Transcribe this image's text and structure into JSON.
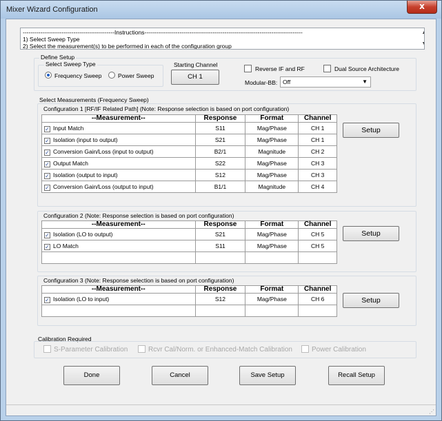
{
  "window": {
    "title": "Mixer Wizard Configuration",
    "close_glyph": "x"
  },
  "instructions": {
    "header": "-----------------------------------------------Instructions---------------------------------------------------------------------------------",
    "lines": [
      "1) Select Sweep Type",
      "2) Select the measurement(s) to be performed in each of the configuration group"
    ]
  },
  "define_setup": {
    "group_label": "Define Setup",
    "sweep_type_label": "Select Sweep Type",
    "frequency_sweep": "Frequency Sweep",
    "power_sweep": "Power Sweep",
    "selected_sweep": "Frequency Sweep",
    "starting_channel_label": "Starting Channel",
    "starting_channel_button": "CH 1",
    "reverse_if_rf": "Reverse IF and RF",
    "dual_source": "Dual Source Architecture",
    "modular_bb_label": "Modular-BB:",
    "modular_bb_value": "Off"
  },
  "select_measurements_label": "Select Measurements (Frequency Sweep)",
  "columns": {
    "measurement": "--Measurement--",
    "response": "Response",
    "format": "Format",
    "channel": "Channel"
  },
  "setup_label": "Setup",
  "configurations": [
    {
      "label": "Configuration 1 [RF/IF Related Path] (Note: Response selection is based on port configuration)",
      "rows": [
        {
          "measurement": "Input Match",
          "response": "S11",
          "format": "Mag/Phase",
          "channel": "CH 1",
          "checked": true
        },
        {
          "measurement": "Isolation (input to output)",
          "response": "S21",
          "format": "Mag/Phase",
          "channel": "CH 1",
          "checked": true
        },
        {
          "measurement": "Conversion Gain/Loss (input to output)",
          "response": "B2/1",
          "format": "Magnitude",
          "channel": "CH 2",
          "checked": true
        },
        {
          "measurement": "Output Match",
          "response": "S22",
          "format": "Mag/Phase",
          "channel": "CH 3",
          "checked": true
        },
        {
          "measurement": "Isolation (output to input)",
          "response": "S12",
          "format": "Mag/Phase",
          "channel": "CH 3",
          "checked": true
        },
        {
          "measurement": "Conversion Gain/Loss (output to input)",
          "response": "B1/1",
          "format": "Magnitude",
          "channel": "CH 4",
          "checked": true
        }
      ]
    },
    {
      "label": "Configuration 2 (Note: Response selection is based on port configuration)",
      "rows": [
        {
          "measurement": "Isolation (LO to output)",
          "response": "S21",
          "format": "Mag/Phase",
          "channel": "CH 5",
          "checked": true
        },
        {
          "measurement": "LO Match",
          "response": "S11",
          "format": "Mag/Phase",
          "channel": "CH 5",
          "checked": true
        }
      ]
    },
    {
      "label": "Configuration 3 (Note: Response selection is based on port configuration)",
      "rows": [
        {
          "measurement": "Isolation (LO to input)",
          "response": "S12",
          "format": "Mag/Phase",
          "channel": "CH 6",
          "checked": true
        }
      ]
    }
  ],
  "calibration": {
    "group_label": "Calibration Required",
    "s_param": "S-Parameter Calibration",
    "rcvr": "Rcvr Cal/Norm. or Enhanced-Match Calibration",
    "power": "Power Calibration"
  },
  "buttons": {
    "done": "Done",
    "cancel": "Cancel",
    "save": "Save Setup",
    "recall": "Recall Setup"
  },
  "colors": {
    "accent": "#1e5ec7",
    "window_frame": "#b9d1ea",
    "close": "#c7402d"
  }
}
